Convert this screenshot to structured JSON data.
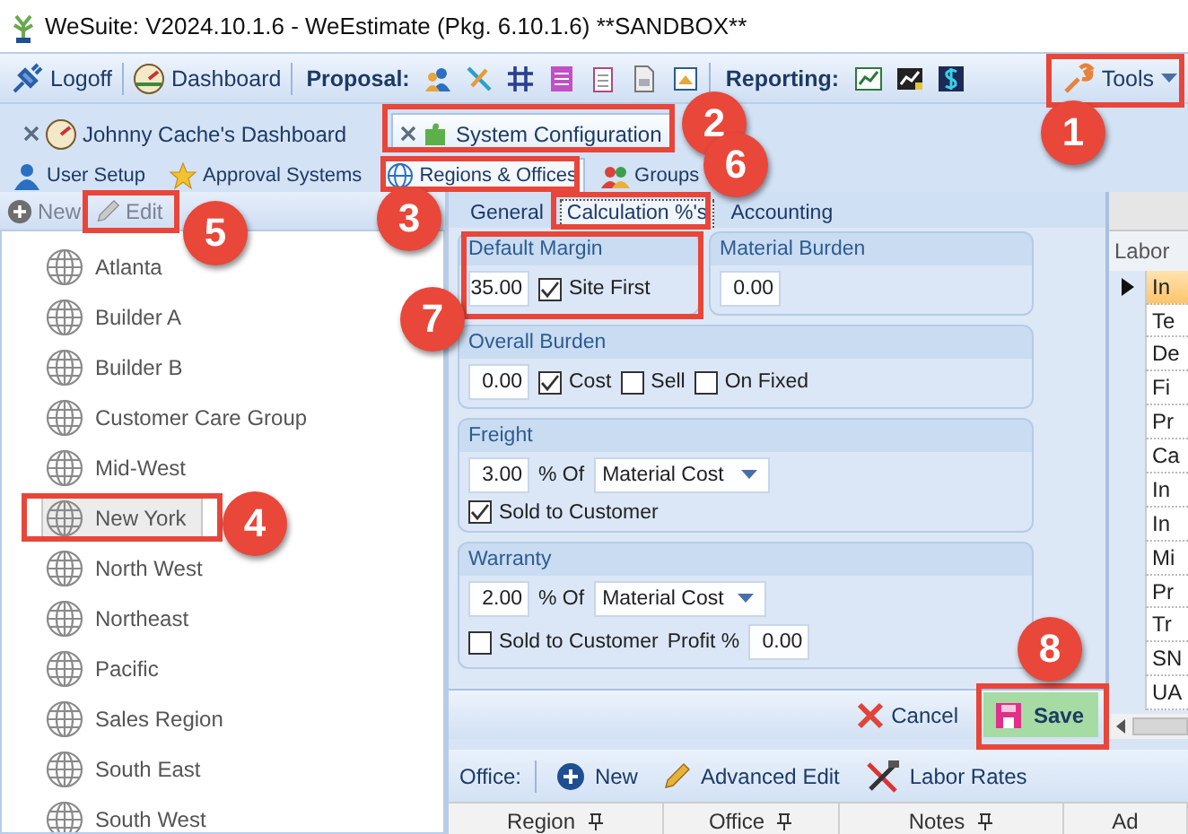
{
  "window": {
    "title": "WeSuite: V2024.10.1.6 - WeEstimate (Pkg. 6.10.1.6) **SANDBOX**"
  },
  "toolbar": {
    "logoff": "Logoff",
    "dashboard": "Dashboard",
    "proposal_label": "Proposal:",
    "reporting_label": "Reporting:",
    "tools": "Tools"
  },
  "document_tabs": [
    {
      "label": "Johnny Cache's Dashboard",
      "selected": false
    },
    {
      "label": "System Configuration",
      "selected": true
    }
  ],
  "config_tabs": [
    {
      "label": "User Setup",
      "selected": false
    },
    {
      "label": "Approval Systems",
      "selected": false
    },
    {
      "label": "Regions & Offices",
      "selected": true
    },
    {
      "label": "Groups",
      "selected": false
    }
  ],
  "regions": {
    "actions": [
      {
        "label": "New",
        "disabled": true
      },
      {
        "label": "Edit",
        "disabled": true
      }
    ],
    "items": [
      {
        "name": "Atlanta",
        "selected": false
      },
      {
        "name": "Builder A",
        "selected": false
      },
      {
        "name": "Builder B",
        "selected": false
      },
      {
        "name": "Customer Care Group",
        "selected": false
      },
      {
        "name": "Mid-West",
        "selected": false
      },
      {
        "name": "New York",
        "selected": true
      },
      {
        "name": "North West",
        "selected": false
      },
      {
        "name": "Northeast",
        "selected": false
      },
      {
        "name": "Pacific",
        "selected": false
      },
      {
        "name": "Sales Region",
        "selected": false
      },
      {
        "name": "South East",
        "selected": false
      },
      {
        "name": "South West",
        "selected": false
      }
    ]
  },
  "region_tabs": [
    {
      "label": "General",
      "selected": false
    },
    {
      "label": "Calculation %'s",
      "selected": true
    },
    {
      "label": "Accounting",
      "selected": false
    }
  ],
  "calculation": {
    "default_margin": {
      "title": "Default Margin",
      "value": "35.00",
      "site_first": {
        "label": "Site First",
        "checked": true
      }
    },
    "material_burden": {
      "title": "Material Burden",
      "value": "0.00"
    },
    "overall_burden": {
      "title": "Overall Burden",
      "value": "0.00",
      "options": [
        {
          "label": "Cost",
          "checked": true
        },
        {
          "label": "Sell",
          "checked": false
        },
        {
          "label": "On Fixed",
          "checked": false
        }
      ]
    },
    "freight": {
      "title": "Freight",
      "value": "3.00",
      "of_label": "% Of",
      "basis": "Material Cost",
      "sold_to_customer": {
        "label": "Sold to Customer",
        "checked": true
      }
    },
    "warranty": {
      "title": "Warranty",
      "value": "2.00",
      "of_label": "% Of",
      "basis": "Material Cost",
      "sold_to_customer": {
        "label": "Sold to Customer",
        "checked": false
      },
      "profit_label": "Profit %",
      "profit": "0.00"
    }
  },
  "form_buttons": {
    "cancel": "Cancel",
    "save": "Save"
  },
  "labor": {
    "header": "Labor",
    "rows": [
      {
        "text": "In",
        "selected": true
      },
      {
        "text": "Te",
        "selected": false
      },
      {
        "text": "De",
        "selected": false
      },
      {
        "text": "Fi",
        "selected": false
      },
      {
        "text": "Pr",
        "selected": false
      },
      {
        "text": "Ca",
        "selected": false
      },
      {
        "text": "In",
        "selected": false
      },
      {
        "text": "In",
        "selected": false
      },
      {
        "text": "Mi",
        "selected": false
      },
      {
        "text": "Pr",
        "selected": false
      },
      {
        "text": "Tr",
        "selected": false
      },
      {
        "text": "SN",
        "selected": false
      },
      {
        "text": "UA",
        "selected": false
      }
    ]
  },
  "office": {
    "label": "Office:",
    "actions": [
      "New",
      "Advanced Edit",
      "Labor Rates"
    ],
    "columns": [
      "Region",
      "Office",
      "Notes",
      "Ad"
    ]
  },
  "annotations": [
    {
      "number": "1"
    },
    {
      "number": "2"
    },
    {
      "number": "3"
    },
    {
      "number": "4"
    },
    {
      "number": "5"
    },
    {
      "number": "6"
    },
    {
      "number": "7"
    },
    {
      "number": "8"
    }
  ]
}
